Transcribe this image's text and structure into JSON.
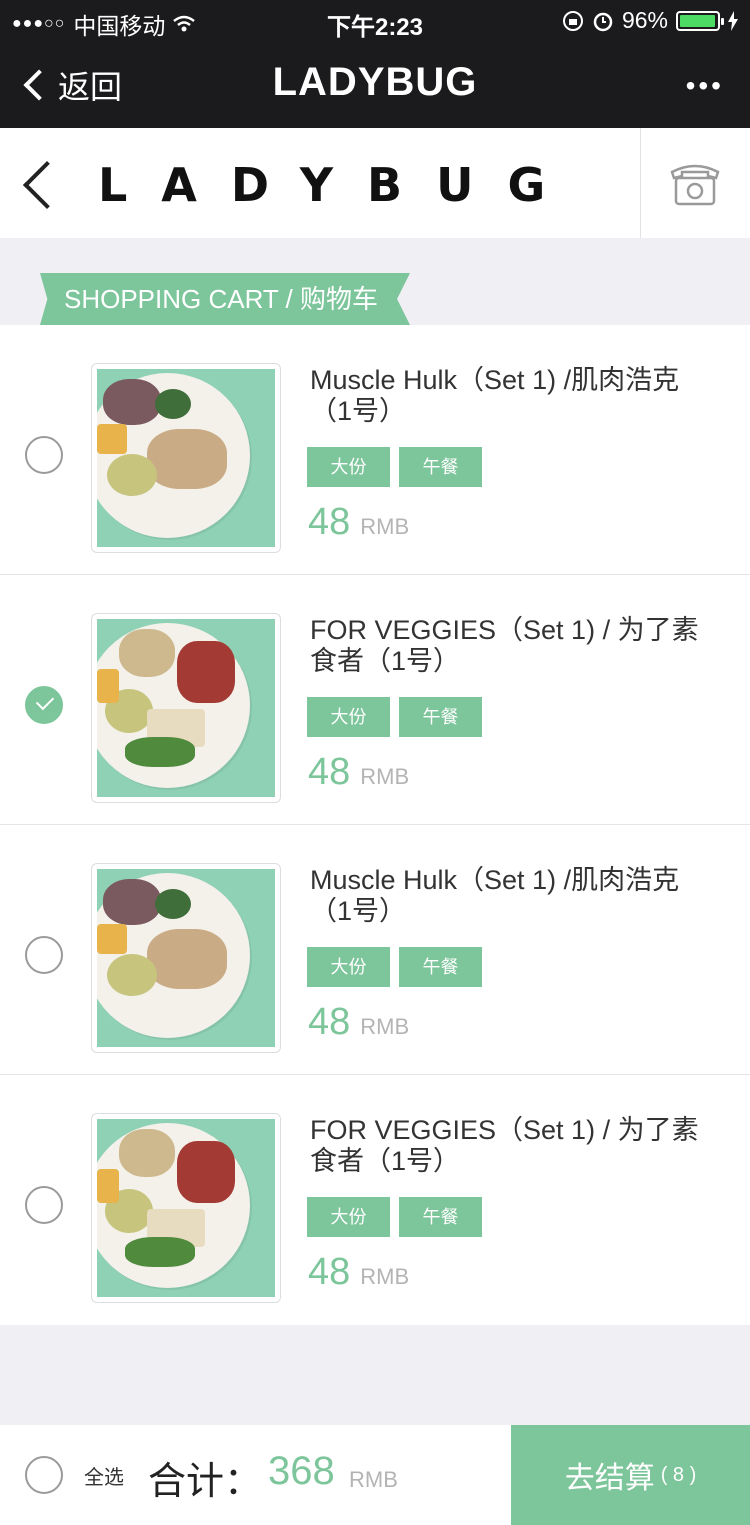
{
  "status_bar": {
    "carrier": "中国移动",
    "time": "下午2:23",
    "battery": "96%"
  },
  "nav": {
    "back_label": "返回",
    "title": "LADYBUG",
    "more": "•••"
  },
  "brand": {
    "logo_text": "LADYBUG"
  },
  "section": {
    "ribbon_label": "SHOPPING CART / 购物车"
  },
  "cart": {
    "items": [
      {
        "name": "Muscle Hulk（Set 1) /肌肉浩克（1号）",
        "tags": [
          "大份",
          "午餐"
        ],
        "price": "48",
        "currency": "RMB",
        "checked": false,
        "dish": "muscle"
      },
      {
        "name": "FOR VEGGIES（Set 1) / 为了素食者（1号）",
        "tags": [
          "大份",
          "午餐"
        ],
        "price": "48",
        "currency": "RMB",
        "checked": true,
        "dish": "veggie"
      },
      {
        "name": "Muscle Hulk（Set 1) /肌肉浩克（1号）",
        "tags": [
          "大份",
          "午餐"
        ],
        "price": "48",
        "currency": "RMB",
        "checked": false,
        "dish": "muscle"
      },
      {
        "name": "FOR VEGGIES（Set 1) / 为了素食者（1号）",
        "tags": [
          "大份",
          "午餐"
        ],
        "price": "48",
        "currency": "RMB",
        "checked": false,
        "dish": "veggie"
      }
    ]
  },
  "footer": {
    "select_all": "全选",
    "total_label": "合计：",
    "total_value": "368",
    "total_currency": "RMB",
    "checkout_label": "去结算",
    "checkout_count": "( 8 )"
  },
  "colors": {
    "accent": "#7dc59a",
    "topbar": "#1b1b1d",
    "background": "#efeff4"
  }
}
